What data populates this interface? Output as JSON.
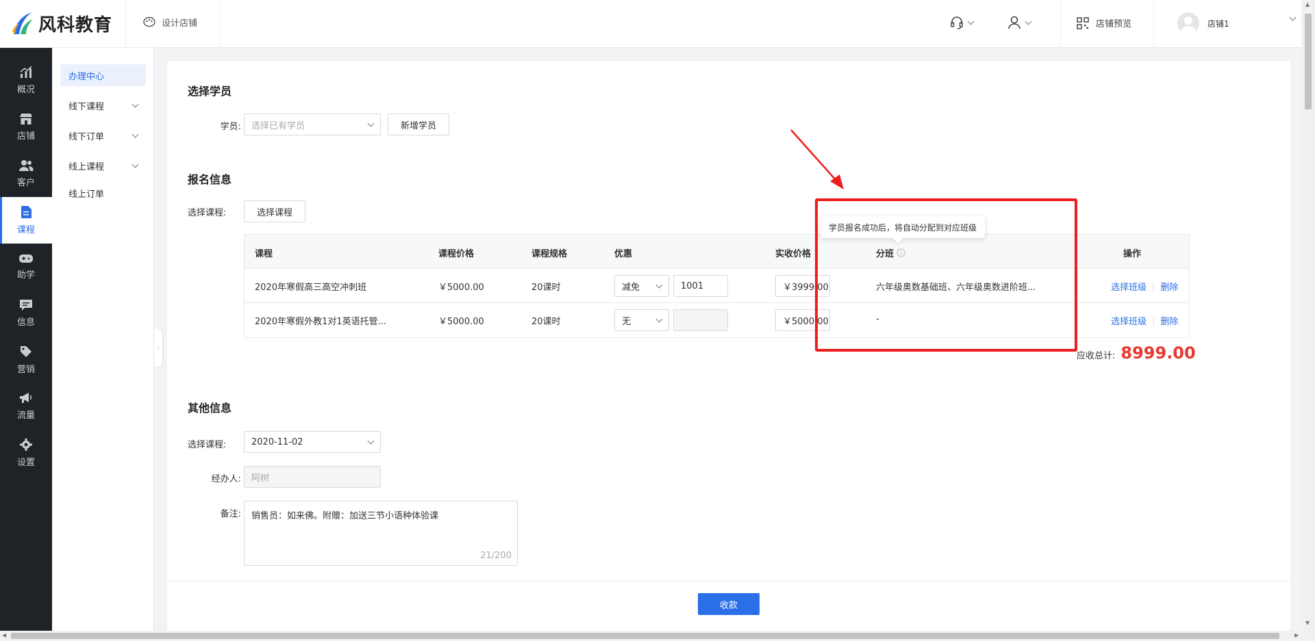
{
  "brand": {
    "name": "风科教育",
    "colors": [
      "#2b6fe6",
      "#36b37e",
      "#f5a623"
    ]
  },
  "header": {
    "design_label": "设计店铺",
    "preview_label": "店铺预览",
    "store_name": "店铺1"
  },
  "sidenav": [
    {
      "label": "概况",
      "icon": "chart-icon"
    },
    {
      "label": "店铺",
      "icon": "store-icon"
    },
    {
      "label": "客户",
      "icon": "customers-icon"
    },
    {
      "label": "课程",
      "icon": "document-icon",
      "active": true
    },
    {
      "label": "助学",
      "icon": "gamepad-icon"
    },
    {
      "label": "信息",
      "icon": "message-icon"
    },
    {
      "label": "营销",
      "icon": "tag-icon"
    },
    {
      "label": "流量",
      "icon": "megaphone-icon"
    },
    {
      "label": "设置",
      "icon": "gear-icon"
    }
  ],
  "subnav": [
    {
      "label": "办理中心",
      "active": true
    },
    {
      "label": "线下课程",
      "expandable": true
    },
    {
      "label": "线下订单",
      "expandable": true
    },
    {
      "label": "线上课程",
      "expandable": true
    },
    {
      "label": "线上订单"
    }
  ],
  "student": {
    "title": "选择学员",
    "label": "学员:",
    "select_placeholder": "选择已有学员",
    "add_button": "新增学员"
  },
  "enroll": {
    "title": "报名信息",
    "course_label": "选择课程:",
    "course_button": "选择课程",
    "columns": [
      "课程",
      "课程价格",
      "课程规格",
      "优惠",
      "实收价格",
      "分班",
      "操作"
    ],
    "rows": [
      {
        "course": "2020年寒假高三高空冲刺班",
        "price": "￥5000.00",
        "spec": "20课时",
        "discount_type": "减免",
        "discount_value": "1001",
        "actual": "￥3999.00",
        "class": "六年级奥数基础班、六年级奥数进阶班...",
        "action_select": "选择班级",
        "action_delete": "删除"
      },
      {
        "course": "2020年寒假外教1对1英语托管...",
        "price": "￥5000.00",
        "spec": "20课时",
        "discount_type": "无",
        "discount_value": "",
        "actual": "￥5000.00",
        "class": "-",
        "action_select": "选择班级",
        "action_delete": "删除"
      }
    ],
    "tooltip": "学员报名成功后，将自动分配到对应班级",
    "total_label": "应收总计:",
    "total_value": "8999.00"
  },
  "other": {
    "title": "其他信息",
    "date_label": "选择课程:",
    "date_value": "2020-11-02",
    "handler_label": "经办人:",
    "handler_value": "阿树",
    "remark_label": "备注:",
    "remark_value": "销售员：如来佛。附赠：加送三节小语种体验课",
    "remark_counter": "21/200"
  },
  "footer": {
    "pay_button": "收款"
  },
  "annotation": {
    "color": "#ee1c1c"
  }
}
